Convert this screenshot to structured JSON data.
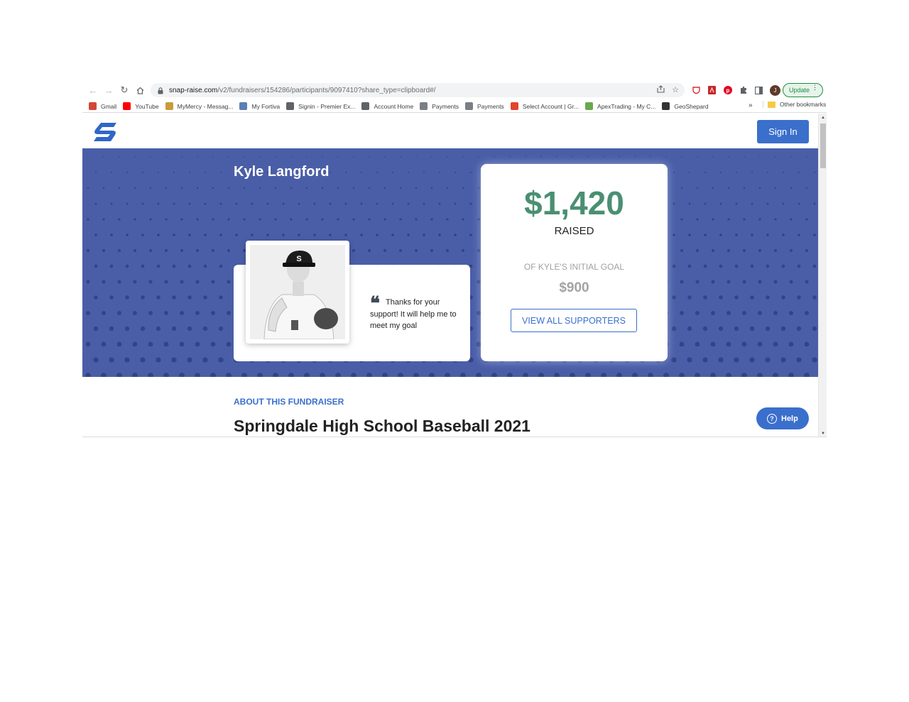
{
  "browser": {
    "url_host": "snap-raise.com",
    "url_path": "/v2/fundraisers/154286/participants/9097410?share_type=clipboard#/",
    "avatar_letter": "J",
    "update_label": "Update",
    "bookmarks": [
      {
        "label": "Gmail",
        "icon": "gmail-icon",
        "color": "#d44638"
      },
      {
        "label": "YouTube",
        "icon": "youtube-icon",
        "color": "#ff0000"
      },
      {
        "label": "MyMercy - Messag...",
        "icon": "mercy-icon",
        "color": "#c89b3c"
      },
      {
        "label": "My Fortiva",
        "icon": "fortiva-icon",
        "color": "#5b7fb5"
      },
      {
        "label": "Signin - Premier Ex...",
        "icon": "globe-icon",
        "color": "#5f6368"
      },
      {
        "label": "Account Home",
        "icon": "globe-icon",
        "color": "#5f6368"
      },
      {
        "label": "Payments",
        "icon": "payments-icon",
        "color": "#7a7f86"
      },
      {
        "label": "Payments",
        "icon": "payments-icon",
        "color": "#7a7f86"
      },
      {
        "label": "Select Account | Gr...",
        "icon": "select-account-icon",
        "color": "#e2452b"
      },
      {
        "label": "ApexTrading - My C...",
        "icon": "apex-icon",
        "color": "#6aa84f"
      },
      {
        "label": "GeoShepard",
        "icon": "geoshepard-icon",
        "color": "#333333"
      }
    ],
    "more_label": "»",
    "other_bookmarks": "Other bookmarks"
  },
  "site": {
    "signin_label": "Sign In",
    "help_label": "Help",
    "brand_color": "#3a6fcc"
  },
  "hero": {
    "participant_name": "Kyle Langford",
    "quote": "Thanks for your support! It will help me to meet my goal",
    "amount_raised": "$1,420",
    "raised_label": "RAISED",
    "goal_label": "OF KYLE'S INITIAL GOAL",
    "goal_amount": "$900",
    "supporters_button": "VIEW ALL SUPPORTERS",
    "hero_color": "#4a5ea8",
    "amount_color": "#4b8f73"
  },
  "about": {
    "section_label": "ABOUT THIS FUNDRAISER",
    "title": "Springdale High School Baseball 2021"
  }
}
